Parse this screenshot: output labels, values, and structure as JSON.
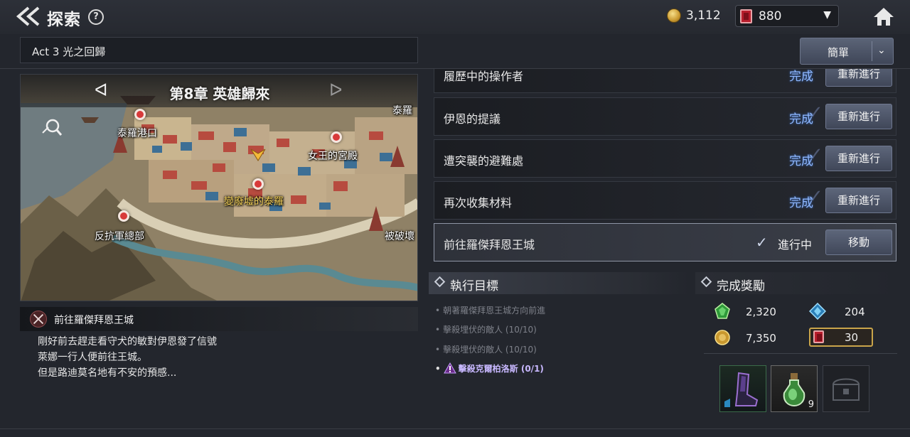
{
  "header": {
    "title": "探索",
    "help_glyph": "?",
    "coins": "3,112",
    "gems": "880",
    "gem_dropdown_glyph": "▼"
  },
  "act": {
    "title": "Act 3 光之回歸"
  },
  "sort_button": {
    "label": "簡單",
    "chevron": "⌄"
  },
  "map": {
    "chapter_title": "第8章 英雄歸來",
    "prev_glyph": "ᐊ",
    "next_glyph": "ᐅ",
    "locations": [
      {
        "label": "泰羅港口"
      },
      {
        "label": "女王的宮殿"
      },
      {
        "label": "變廢墟的泰羅"
      },
      {
        "label": "反抗軍總部"
      },
      {
        "label": "被破壞"
      },
      {
        "label": "泰羅"
      }
    ]
  },
  "quest": {
    "name": "前往羅傑拜恩王城",
    "description": [
      "剛好前去趕走看守犬的敏對伊恩發了信號",
      "萊娜一行人便前往王城。",
      "但是路迪莫名地有不安的預感..."
    ]
  },
  "quest_list": [
    {
      "name": "履歷中的操作者",
      "status": "完成",
      "button": "重新進行"
    },
    {
      "name": "伊恩的提議",
      "status": "完成",
      "button": "重新進行"
    },
    {
      "name": "遭突襲的避難處",
      "status": "完成",
      "button": "重新進行"
    },
    {
      "name": "再次收集材料",
      "status": "完成",
      "button": "重新進行"
    },
    {
      "name": "前往羅傑拜恩王城",
      "status": "進行中",
      "button": "移動"
    }
  ],
  "objectives": {
    "title": "執行目標",
    "items": [
      {
        "text": "朝著羅傑拜恩王城方向前進"
      },
      {
        "text": "擊殺埋伏的敵人 (10/10)"
      },
      {
        "text": "擊殺埋伏的敵人 (10/10)"
      },
      {
        "text": "擊殺克爾柏洛斯 (0/1)"
      }
    ]
  },
  "rewards": {
    "title": "完成獎勵",
    "exp": "2,320",
    "crystal": "204",
    "gold": "7,350",
    "gems": "30",
    "item_count": "9"
  },
  "colors": {
    "status_complete": "#8fb8ff",
    "button_bg": "#4f576a",
    "boss_objective": "#c8b8ff"
  }
}
